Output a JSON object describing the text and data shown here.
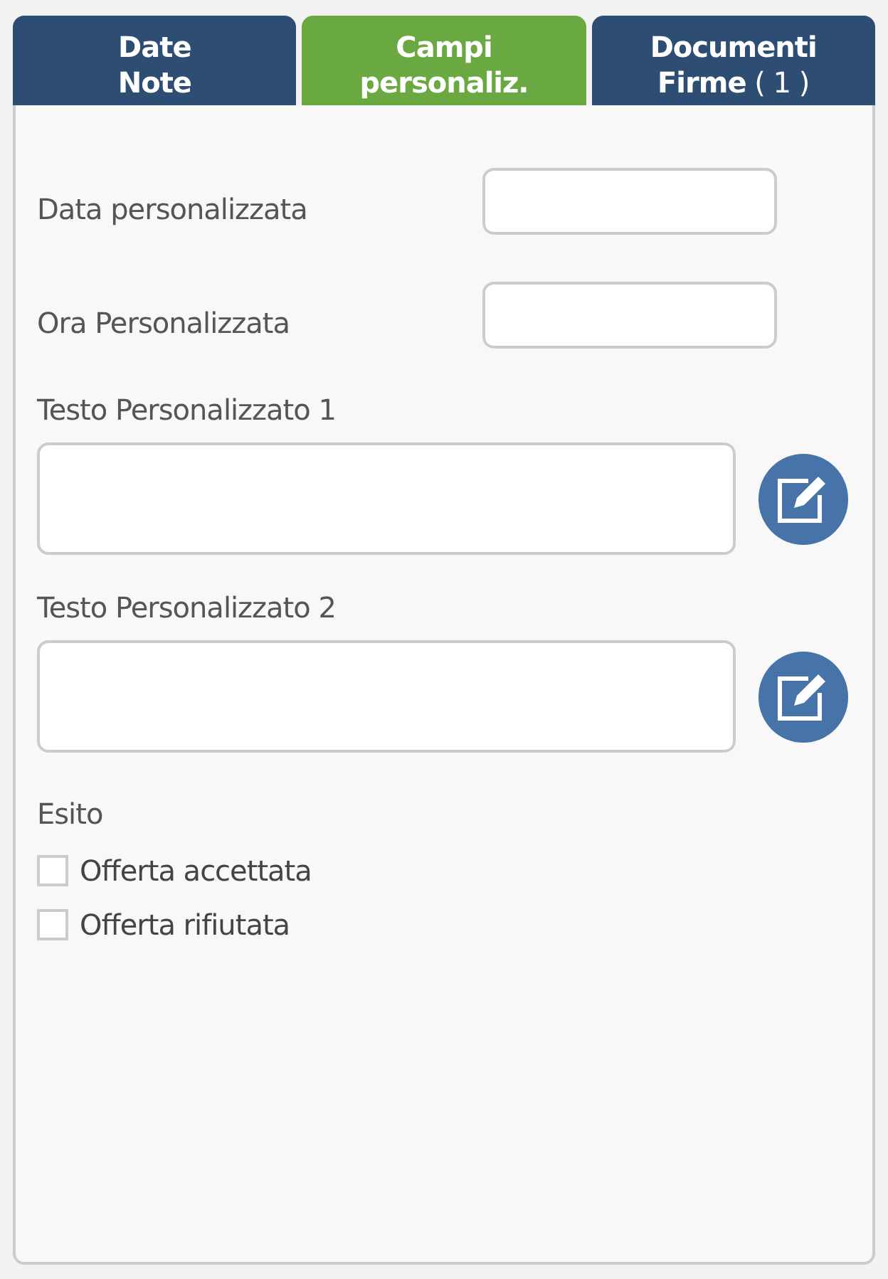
{
  "tabs": [
    {
      "lines": [
        "Date",
        "Note"
      ],
      "selected": false
    },
    {
      "lines": [
        "Campi",
        "personaliz."
      ],
      "selected": true
    },
    {
      "lines": [
        "Documenti",
        "Firme"
      ],
      "count": "( 1 )",
      "selected": false
    }
  ],
  "short_fields": [
    {
      "label": "Data personalizzata"
    },
    {
      "label": "Ora Personalizzata"
    }
  ],
  "text_fields": [
    {
      "label": "Testo Personalizzato 1"
    },
    {
      "label": "Testo Personalizzato 2"
    }
  ],
  "outcome": {
    "label": "Esito",
    "options": [
      {
        "label": "Offerta accettata",
        "checked": false
      },
      {
        "label": "Offerta rifiutata",
        "checked": false
      }
    ]
  }
}
